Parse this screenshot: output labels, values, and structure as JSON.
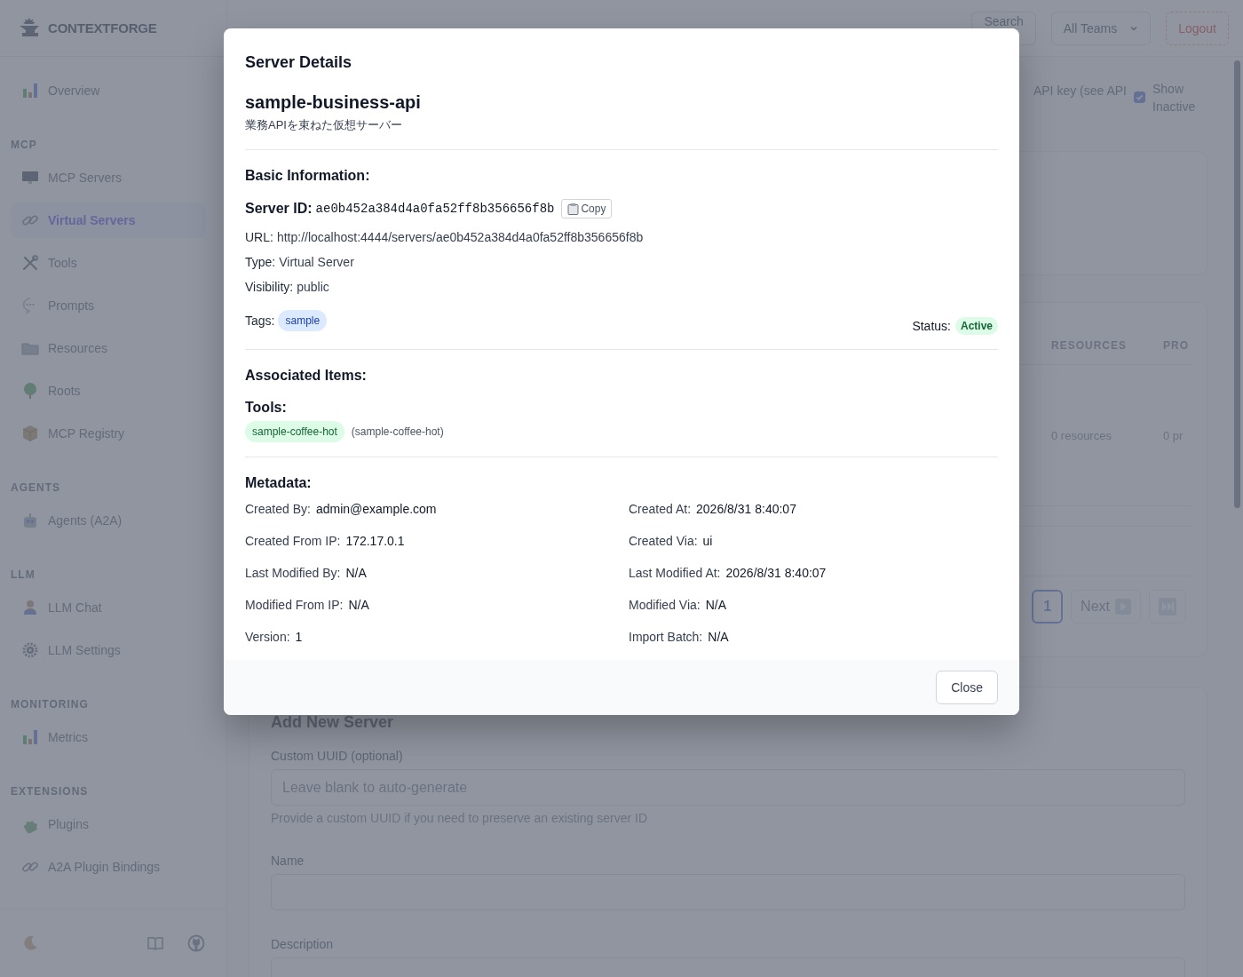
{
  "sidebar": {
    "brand": "CONTEXTFORGE",
    "sections": [
      {
        "items": [
          {
            "label": "Overview",
            "selected": false
          }
        ]
      },
      {
        "heading": "MCP",
        "items": [
          {
            "label": "MCP Servers",
            "selected": false
          },
          {
            "label": "Virtual Servers",
            "selected": true
          },
          {
            "label": "Tools",
            "selected": false
          },
          {
            "label": "Prompts",
            "selected": false
          },
          {
            "label": "Resources",
            "selected": false
          },
          {
            "label": "Roots",
            "selected": false
          },
          {
            "label": "MCP Registry",
            "selected": false
          }
        ]
      },
      {
        "heading": "AGENTS",
        "items": [
          {
            "label": "Agents (A2A)",
            "selected": false
          }
        ]
      },
      {
        "heading": "LLM",
        "items": [
          {
            "label": "LLM Chat",
            "selected": false
          },
          {
            "label": "LLM Settings",
            "selected": false
          }
        ]
      },
      {
        "heading": "MONITORING",
        "items": [
          {
            "label": "Metrics",
            "selected": false
          }
        ]
      },
      {
        "heading": "EXTENSIONS",
        "items": [
          {
            "label": "Plugins",
            "selected": false
          },
          {
            "label": "A2A Plugin Bindings",
            "selected": false
          }
        ]
      }
    ]
  },
  "header": {
    "buttons": [
      {
        "label": "Search",
        "kind": "plain"
      },
      {
        "label": "All Teams",
        "kind": "dropdown"
      },
      {
        "label": "Logout",
        "kind": "danger"
      }
    ]
  },
  "servers_panel": {
    "api_note": "API key (see API",
    "show_inactive": {
      "label": "Show Inactive",
      "checked": true
    },
    "table": {
      "columns": [
        "RESOURCES",
        "PRO"
      ],
      "rows": [
        [
          "0 resources",
          "0 pr"
        ]
      ]
    },
    "pagination": {
      "pages": [
        {
          "label": "1",
          "selected": true
        }
      ],
      "next": {
        "label": "Next",
        "disabled": true
      }
    }
  },
  "add_server_form": {
    "title": "Add New Server",
    "fields": [
      {
        "label": "Custom UUID (optional)",
        "placeholder": "Leave blank to auto-generate",
        "help": "Provide a custom UUID if you need to preserve an existing server ID"
      },
      {
        "label": "Name"
      },
      {
        "label": "Description"
      }
    ]
  },
  "modal": {
    "title": "Server Details",
    "server_name": "sample-business-api",
    "description": "業務APIを束ねた仮想サーバー",
    "basic": {
      "heading": "Basic Information:",
      "server_id": {
        "label": "Server ID:",
        "value": "ae0b452a384d4a0fa52ff8b356656f8b",
        "copy": "Copy"
      },
      "fields": [
        {
          "label": "URL:",
          "value": "http://localhost:4444/servers/ae0b452a384d4a0fa52ff8b356656f8b"
        },
        {
          "label": "Type:",
          "value": "Virtual Server"
        },
        {
          "label": "Visibility:",
          "value": "public"
        }
      ],
      "tags": {
        "label": "Tags:",
        "items": [
          "sample"
        ]
      },
      "status": {
        "label": "Status:",
        "value": "Active"
      }
    },
    "associated": {
      "heading": "Associated Items:",
      "groups": [
        {
          "label": "Tools:",
          "items": [
            {
              "name": "sample-coffee-hot",
              "note": "(sample-coffee-hot)"
            }
          ]
        }
      ]
    },
    "metadata": {
      "heading": "Metadata:",
      "items": [
        {
          "label": "Created By:",
          "value": "admin@example.com"
        },
        {
          "label": "Created At:",
          "value": "2026/8/31 8:40:07"
        },
        {
          "label": "Created From IP:",
          "value": "172.17.0.1"
        },
        {
          "label": "Created Via:",
          "value": "ui"
        },
        {
          "label": "Last Modified By:",
          "value": "N/A"
        },
        {
          "label": "Last Modified At:",
          "value": "2026/8/31 8:40:07"
        },
        {
          "label": "Modified From IP:",
          "value": "N/A"
        },
        {
          "label": "Modified Via:",
          "value": "N/A"
        },
        {
          "label": "Version:",
          "value": "1"
        },
        {
          "label": "Import Batch:",
          "value": "N/A"
        }
      ]
    },
    "close": "Close"
  }
}
